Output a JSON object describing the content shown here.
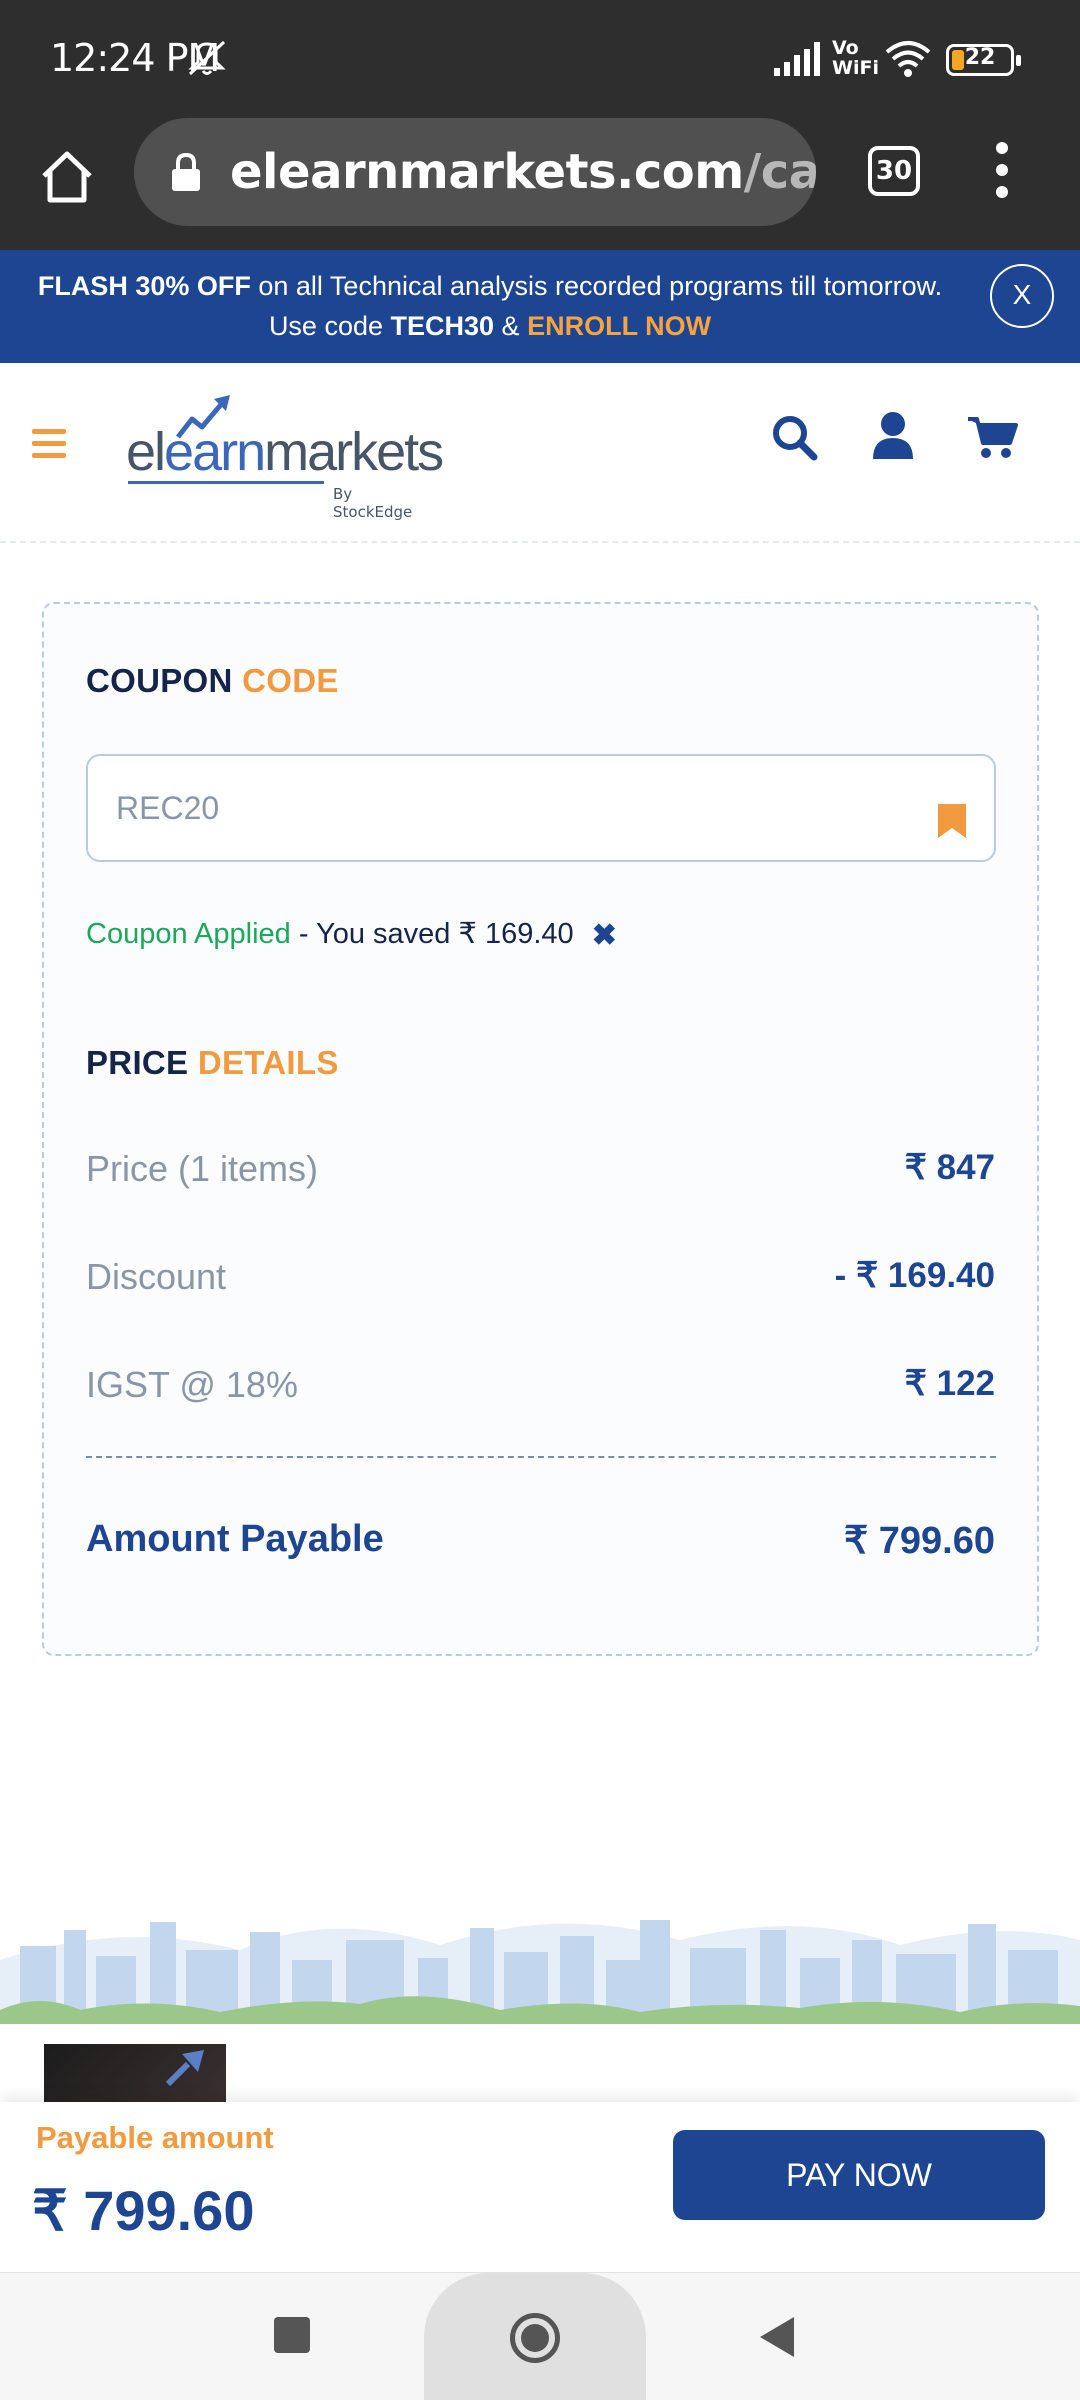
{
  "status_bar": {
    "time": "12:24 PM",
    "network_label": "Vo WiFi",
    "battery_level": "22",
    "battery_color": "#f5a623"
  },
  "browser": {
    "url_main": "elearnmarkets.com",
    "url_path": "/cartlive",
    "tabs_count": "30"
  },
  "promo": {
    "highlight": "FLASH 30% OFF",
    "text_1": " on all Technical analysis recorded programs till tomorrow. Use code ",
    "code": "TECH30",
    "text_2": " & ",
    "cta": "ENROLL NOW",
    "close_label": "X",
    "background": "#1d4592"
  },
  "header": {
    "logo_part_1": "el",
    "logo_part_2": "earn",
    "logo_part_3": "markets",
    "logo_sub": "By StockEdge",
    "icons": [
      "menu-icon",
      "search-icon",
      "user-icon",
      "cart-icon"
    ]
  },
  "coupon": {
    "title_1": "COUPON",
    "title_2": "CODE",
    "input_value": "REC20",
    "applied_label": "Coupon Applied",
    "saved_text": " - You saved ₹ 169.40",
    "remove_icon": "✖"
  },
  "price_details": {
    "title_1": "PRICE",
    "title_2": "DETAILS",
    "rows": [
      {
        "label": "Price (1 items)",
        "value": "₹ 847"
      },
      {
        "label": "Discount",
        "value": "- ₹ 169.40"
      },
      {
        "label": "IGST @ 18%",
        "value": "₹ 122"
      }
    ],
    "total_label": "Amount Payable",
    "total_value": "₹ 799.60"
  },
  "pay_bar": {
    "label": "Payable amount",
    "amount": "₹ 799.60",
    "button_label": "PAY NOW"
  },
  "colors": {
    "accent_blue": "#1d4592",
    "accent_orange": "#f29a3f",
    "success_green": "#1aa85b"
  }
}
